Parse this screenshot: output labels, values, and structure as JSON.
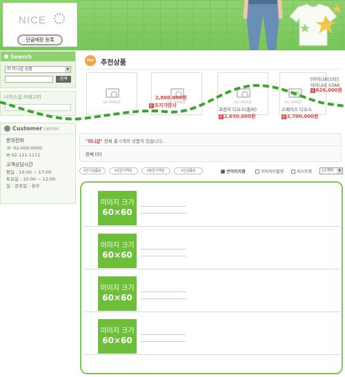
{
  "header": {
    "logo_text": "NICE",
    "register_button": "단골매장 등록"
  },
  "sidebar": {
    "search_title": "Search",
    "search_select": "미 미니샵 상품",
    "search_button": "검색",
    "category_title": "나이스샵 카테고리",
    "customer_title": "Customer",
    "customer_sub": "center",
    "inquiry_label": "문의전화",
    "phone": "02-000-0000",
    "fax": "02-111-1111",
    "hours_label": "고객상담시간",
    "weekday": "평일 : 10:00 ~ 17:00",
    "saturday": "토요일 : 10:00 ~ 12:00",
    "holiday": "일 · 공휴일 : 휴무"
  },
  "recommended": {
    "hot_badge": "Hot",
    "title": "추천상품",
    "no_image": "NO IMAGE",
    "products": [
      {
        "name": "",
        "price": ""
      },
      {
        "name": "",
        "price": "2,800,000원",
        "extra": "조지가방사"
      },
      {
        "name": "프렌치 디오스(홈바)",
        "price": "2,650,000원"
      },
      {
        "name": "스페이스 디오스",
        "price": "2,700,000원"
      },
      {
        "name": "[아이나비스타]",
        "name2": "아이나비 STAR",
        "price": "626,000원"
      }
    ]
  },
  "info": {
    "shop": "\"미니샵\"",
    "text": "전체 총 0개의 상품이 있습니다.",
    "total": "전체 [0]"
  },
  "sort": {
    "popular": "인기상품순",
    "low_price": "낮은가격순",
    "high_price": "높은가격순",
    "new": "신상품순"
  },
  "view": {
    "large": "큰이미지형",
    "double": "이미지더블형",
    "list": "리스트형",
    "count": "12개씩"
  },
  "list": {
    "thumb_line1": "이미지 크기",
    "thumb_line2": "60×60"
  }
}
